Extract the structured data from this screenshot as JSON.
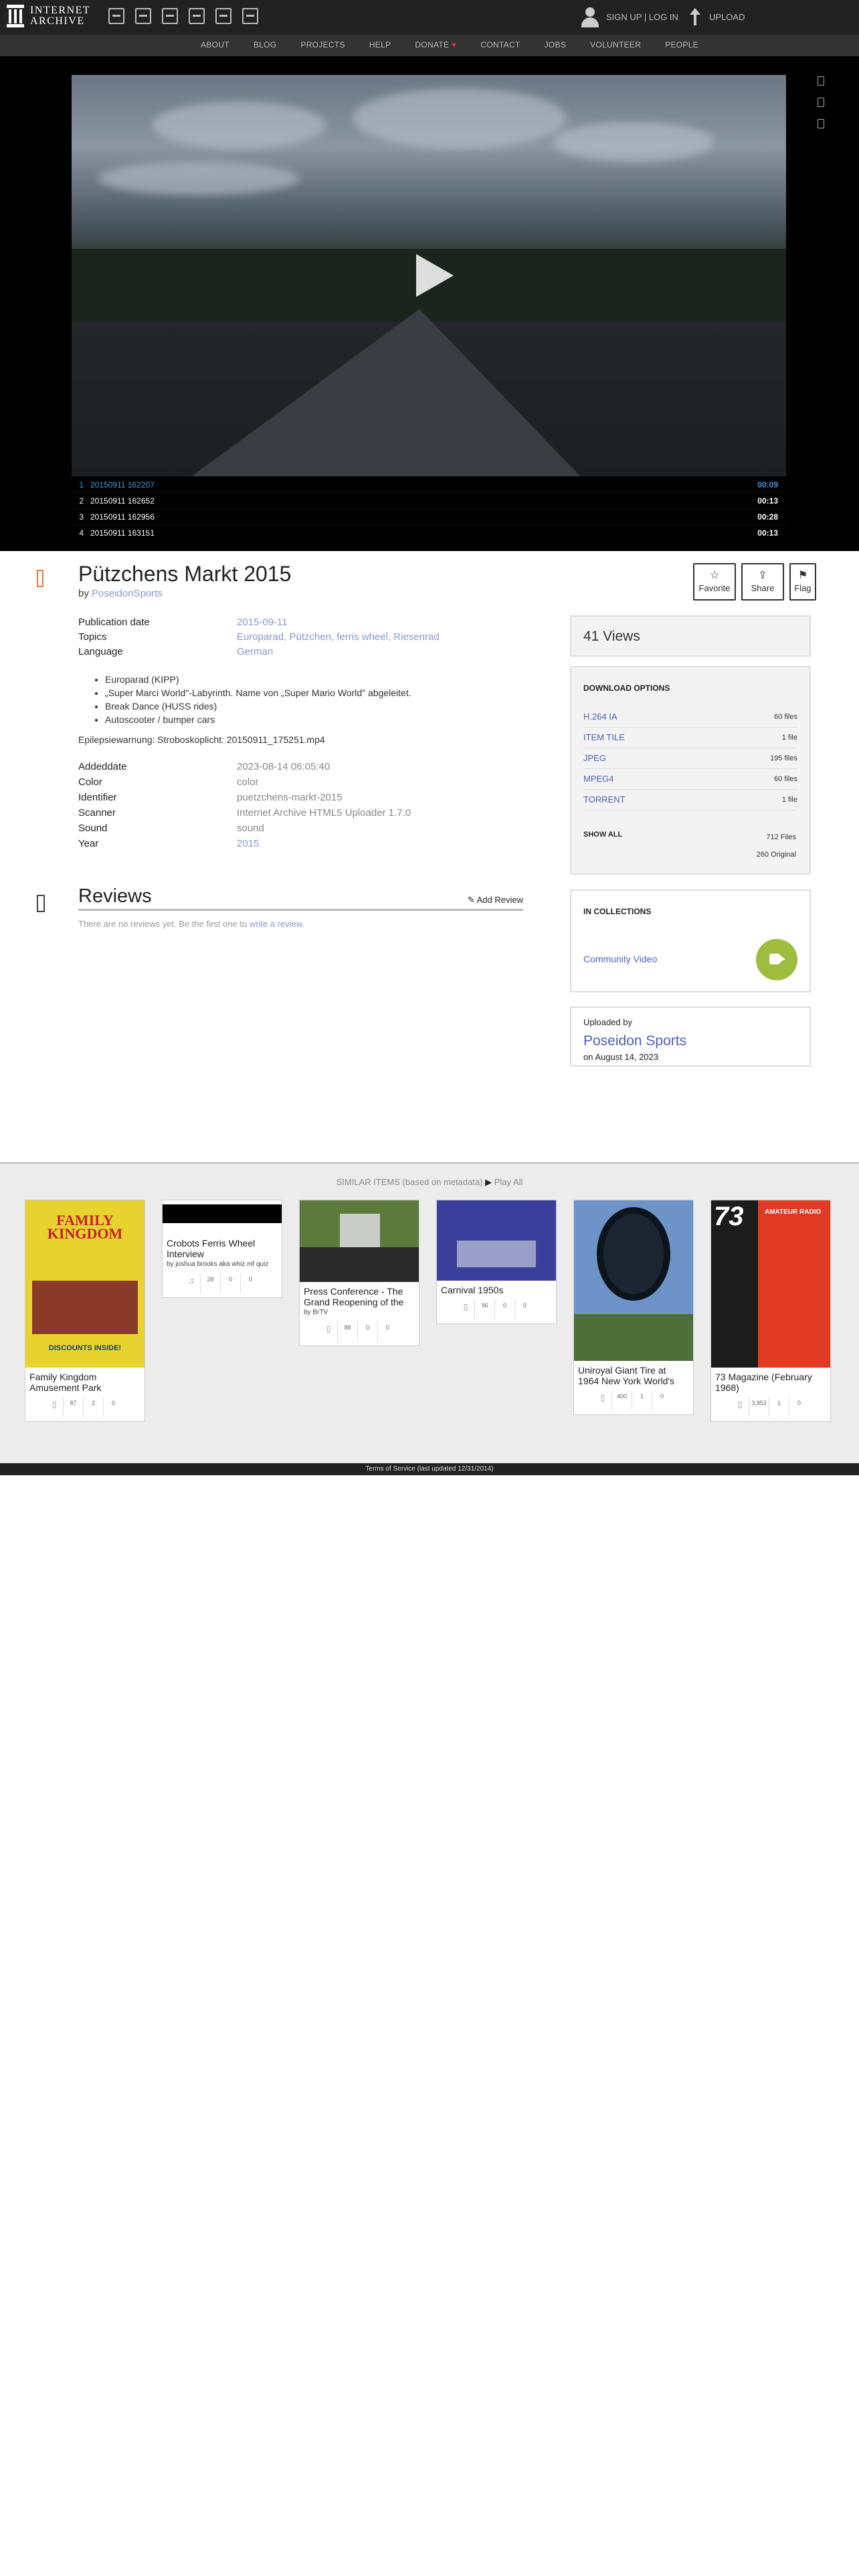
{
  "header": {
    "logo_line1": "INTERNET",
    "logo_line2": "ARCHIVE",
    "media_icons": [
      "web-icon",
      "texts-icon",
      "video-icon",
      "audio-icon",
      "software-icon",
      "images-icon"
    ],
    "signup": "SIGN UP | LOG IN",
    "upload": "UPLOAD"
  },
  "nav": {
    "items": [
      "ABOUT",
      "BLOG",
      "PROJECTS",
      "HELP",
      "DONATE",
      "CONTACT",
      "JOBS",
      "VOLUNTEER",
      "PEOPLE"
    ],
    "heart": "♥"
  },
  "playlist": [
    {
      "idx": "1",
      "name": "20150911 162207",
      "dur": "00:09"
    },
    {
      "idx": "2",
      "name": "20150911 162652",
      "dur": "00:13"
    },
    {
      "idx": "3",
      "name": "20150911 162956",
      "dur": "00:28"
    },
    {
      "idx": "4",
      "name": "20150911 163151",
      "dur": "00:13"
    }
  ],
  "item": {
    "title": "Pützchens Markt 2015",
    "by_prefix": "by",
    "creator": "PoseidonSports",
    "actions": {
      "favorite": "Favorite",
      "share": "Share",
      "flag": "Flag",
      "favorite_icon": "☆",
      "share_icon": "⇪",
      "flag_icon": "⚑"
    },
    "metadata": {
      "pubdate_label": "Publication date",
      "pubdate": "2015-09-11",
      "topics_label": "Topics",
      "topics": "Europarad, Pützchen, ferris wheel, Riesenrad",
      "language_label": "Language",
      "language": "German"
    },
    "description_items": [
      "Europarad (KIPP)",
      "„Super Marci World\"-Labyrinth. Name von „Super Mario World\" abgeleitet.",
      "Break Dance (HUSS rides)",
      "Autoscooter / bumper cars"
    ],
    "description_line": "Epilepsiewarnung: Stroboskoplicht: 20150911_175251.mp4",
    "extra": {
      "addeddate_label": "Addeddate",
      "addeddate": "2023-08-14 06:05:40",
      "color_label": "Color",
      "color": "color",
      "identifier_label": "Identifier",
      "identifier": "puetzchens-markt-2015",
      "scanner_label": "Scanner",
      "scanner": "Internet Archive HTML5 Uploader 1.7.0",
      "sound_label": "Sound",
      "sound": "sound",
      "year_label": "Year",
      "year": "2015"
    }
  },
  "reviews": {
    "title": "Reviews",
    "add": "Add Review",
    "empty_prefix": "There are no reviews yet. Be the first one to",
    "empty_link": "write a review."
  },
  "sidebar": {
    "views": "41 Views",
    "download_title": "DOWNLOAD OPTIONS",
    "downloads": [
      {
        "fmt": "H.264 IA",
        "count": "60 files"
      },
      {
        "fmt": "ITEM TILE",
        "count": "1 file"
      },
      {
        "fmt": "JPEG",
        "count": "195 files"
      },
      {
        "fmt": "MPEG4",
        "count": "60 files"
      },
      {
        "fmt": "TORRENT",
        "count": "1 file"
      }
    ],
    "show_all": "SHOW ALL",
    "total_files": "712 Files",
    "original_files": "260 Original",
    "collections_title": "IN COLLECTIONS",
    "collection_name": "Community Video",
    "uploaded_by_label": "Uploaded by",
    "uploader": "Poseidon Sports",
    "upload_date": "on August 14, 2023"
  },
  "similar": {
    "heading": "SIMILAR ITEMS (based on metadata)",
    "play_all": "Play All",
    "play_icon": "▶",
    "cards": [
      {
        "title": "Family Kingdom Amusement Park",
        "by": "",
        "views": "87",
        "favs": "2",
        "reviews": "0"
      },
      {
        "title": "Crobots Ferris Wheel Interview",
        "by": "by joshua brooks aka whiz mf quiz",
        "views": "28",
        "favs": "0",
        "reviews": "0"
      },
      {
        "title": "Press Conference - The Grand Reopening of the",
        "by": "by BrTV",
        "views": "88",
        "favs": "0",
        "reviews": "0"
      },
      {
        "title": "Carnival 1950s",
        "by": "",
        "views": "96",
        "favs": "0",
        "reviews": "0"
      },
      {
        "title": "Uniroyal Giant Tire at 1964 New York World's",
        "by": "",
        "views": "400",
        "favs": "1",
        "reviews": "0"
      },
      {
        "title": "73 Magazine (February 1968)",
        "by": "",
        "views": "3,953",
        "favs": "1",
        "reviews": "0"
      }
    ],
    "thumb_texts": {
      "family_kingdom": "FAMILY KINGDOM",
      "discounts": "DISCOUNTS INSIDE!",
      "mag_number": "73",
      "mag_header": "AMATEUR RADIO"
    }
  },
  "footer": "Terms of Service (last updated 12/31/2014)",
  "colors": {
    "accent": "#8a96d3",
    "link": "#4c5fbd",
    "film": "#e87a37",
    "collection": "#9ebd3e"
  }
}
